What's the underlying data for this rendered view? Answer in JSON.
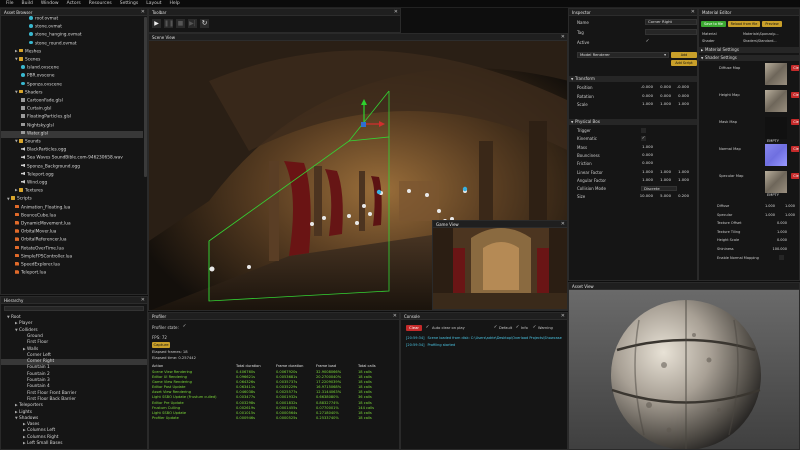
{
  "menu": [
    "File",
    "Build",
    "Window",
    "Actors",
    "Resources",
    "Settings",
    "Layout",
    "Help"
  ],
  "asset_browser": {
    "title": "Asset Browser",
    "rows": [
      {
        "label": "roof.ovmat",
        "indent": 28,
        "icon": "sphere"
      },
      {
        "label": "stone.ovmat",
        "indent": 28,
        "icon": "sphere"
      },
      {
        "label": "stone_hanging.ovmat",
        "indent": 28,
        "icon": "sphere"
      },
      {
        "label": "stone_round.ovmat",
        "indent": 28,
        "icon": "sphere"
      },
      {
        "label": "Meshes",
        "indent": 14,
        "icon": "folder",
        "tri": "▶"
      },
      {
        "label": "Scenes",
        "indent": 14,
        "icon": "folder",
        "tri": "▼"
      },
      {
        "label": "Island.ovscene",
        "indent": 20,
        "icon": "sphere"
      },
      {
        "label": "PBR.ovscene",
        "indent": 20,
        "icon": "sphere"
      },
      {
        "label": "Sponza.ovscene",
        "indent": 20,
        "icon": "sphere"
      },
      {
        "label": "Shaders",
        "indent": 14,
        "icon": "folder",
        "tri": "▼"
      },
      {
        "label": "CartoonFade.glsl",
        "indent": 20,
        "icon": "file"
      },
      {
        "label": "Curtain.glsl",
        "indent": 20,
        "icon": "file"
      },
      {
        "label": "FloatingParticles.glsl",
        "indent": 20,
        "icon": "file"
      },
      {
        "label": "Nightsky.glsl",
        "indent": 20,
        "icon": "file"
      },
      {
        "label": "Water.glsl",
        "indent": 20,
        "icon": "file",
        "selected": true
      },
      {
        "label": "Sounds",
        "indent": 14,
        "icon": "folder",
        "tri": "▼"
      },
      {
        "label": "BlackParticles.ogg",
        "indent": 20,
        "icon": "sound"
      },
      {
        "label": "Sea Waves SoundBible.com-946230658.wav",
        "indent": 20,
        "icon": "sound"
      },
      {
        "label": "Sponza_Background.ogg",
        "indent": 20,
        "icon": "sound"
      },
      {
        "label": "Teleport.ogg",
        "indent": 20,
        "icon": "sound"
      },
      {
        "label": "Wind.ogg",
        "indent": 20,
        "icon": "sound"
      },
      {
        "label": "Textures",
        "indent": 14,
        "icon": "folder",
        "tri": "▶"
      },
      {
        "label": "Scripts",
        "indent": 6,
        "icon": "folder",
        "tri": "▼"
      },
      {
        "label": "Animation_Floating.lua",
        "indent": 14,
        "icon": "script"
      },
      {
        "label": "BounceCube.lua",
        "indent": 14,
        "icon": "script"
      },
      {
        "label": "DynamicMovement.lua",
        "indent": 14,
        "icon": "script"
      },
      {
        "label": "OrbitalMover.lua",
        "indent": 14,
        "icon": "script"
      },
      {
        "label": "OrbitalReferencer.lua",
        "indent": 14,
        "icon": "script"
      },
      {
        "label": "RotateOverTime.lua",
        "indent": 14,
        "icon": "script"
      },
      {
        "label": "SimpleFPSController.lua",
        "indent": 14,
        "icon": "script"
      },
      {
        "label": "SpeedExplorer.lua",
        "indent": 14,
        "icon": "script"
      },
      {
        "label": "Teleport.lua",
        "indent": 14,
        "icon": "script"
      }
    ]
  },
  "hierarchy": {
    "title": "Hierarchy",
    "rows": [
      {
        "label": "Root",
        "indent": 6,
        "tri": "▼"
      },
      {
        "label": "Player",
        "indent": 14,
        "tri": "▶"
      },
      {
        "label": "Colliders",
        "indent": 14,
        "tri": "▼"
      },
      {
        "label": "Ground",
        "indent": 26,
        "tri": ""
      },
      {
        "label": "First Floor",
        "indent": 26,
        "tri": ""
      },
      {
        "label": "Walls",
        "indent": 22,
        "tri": "▶"
      },
      {
        "label": "Corner Left",
        "indent": 26,
        "tri": ""
      },
      {
        "label": "Corner Right",
        "indent": 26,
        "tri": "",
        "selected": true
      },
      {
        "label": "Fountain 1",
        "indent": 26,
        "tri": ""
      },
      {
        "label": "Fountain 2",
        "indent": 26,
        "tri": ""
      },
      {
        "label": "Fountain 3",
        "indent": 26,
        "tri": ""
      },
      {
        "label": "Fountain 4",
        "indent": 26,
        "tri": ""
      },
      {
        "label": "First Floor Front Barrier",
        "indent": 26,
        "tri": ""
      },
      {
        "label": "First Floor Back Barrier",
        "indent": 26,
        "tri": ""
      },
      {
        "label": "Teleporters",
        "indent": 14,
        "tri": "▶"
      },
      {
        "label": "Lights",
        "indent": 14,
        "tri": "▶"
      },
      {
        "label": "Shadows",
        "indent": 14,
        "tri": "▼"
      },
      {
        "label": "Vases",
        "indent": 22,
        "tri": "▶"
      },
      {
        "label": "Columns Left",
        "indent": 22,
        "tri": "▶"
      },
      {
        "label": "Columns Right",
        "indent": 22,
        "tri": "▶"
      },
      {
        "label": "Left Small Bases",
        "indent": 22,
        "tri": "▶"
      }
    ]
  },
  "toolbar": {
    "title": "Toolbar"
  },
  "scene_view": {
    "title": "Scene View"
  },
  "game_view": {
    "title": "Game View"
  },
  "profiler": {
    "title": "Profiler",
    "profiler_state": "Profiler state:",
    "fps": "FPS: 72",
    "capture": "Capture",
    "elapsed_frames": "Elapsed frames: 18",
    "elapsed_time": "Elapsed time: 0.257442",
    "columns": [
      "Action",
      "Total duration",
      "Frame duration",
      "Frame load",
      "Total calls"
    ],
    "rows": [
      [
        "Scene View Rendering",
        "0.406760s",
        "0.0067920s",
        "32.9008066%",
        "18 calls"
      ],
      [
        "Editor UI Rendering",
        "0.096621s",
        "0.0053681s",
        "20.2700040%",
        "18 calls"
      ],
      [
        "Game View Rendering",
        "0.064326s",
        "0.0035737s",
        "17.2209039%",
        "18 calls"
      ],
      [
        "Editor Post Update",
        "0.063411s",
        "0.0035229s",
        "16.9715068%",
        "18 calls"
      ],
      [
        "Asset View Rendering",
        "0.046038s",
        "0.0025577s",
        "12.3144063%",
        "18 calls"
      ],
      [
        "Light SSBO Update (Frustum culled)",
        "0.003477s",
        "0.0001932s",
        "0.6638080%",
        "36 calls"
      ],
      [
        "Editor Pre Update",
        "0.003298s",
        "0.0001832s",
        "0.8832774%",
        "18 calls"
      ],
      [
        "Frustum Culling",
        "0.002619s",
        "0.0001455s",
        "0.0770001%",
        "144 calls"
      ],
      [
        "Light SSBO Update",
        "0.001015s",
        "0.0000564s",
        "0.2718040%",
        "18 calls"
      ],
      [
        "Profiler Update",
        "0.000946s",
        "0.0000525s",
        "0.2533740%",
        "18 calls"
      ]
    ]
  },
  "console": {
    "title": "Console",
    "clear": "Clear",
    "auto_clear": "Auto clear on play",
    "filters": [
      "Default",
      "Info",
      "Warning"
    ],
    "logs": [
      {
        "time": "[20:59:34]",
        "text": "Scene loaded from disk: C:\\Users\\adrie\\Desktop\\Overload Projects\\Showcase"
      },
      {
        "time": "[20:59:34]",
        "text": "Profiling started"
      }
    ]
  },
  "inspector": {
    "title": "Inspector",
    "name_label": "Name",
    "name_value": "Corner Right",
    "tag_label": "Tag",
    "tag_value": "",
    "active_label": "Active",
    "component_select": "Model Renderer",
    "add_component": "Add Component",
    "add_script": "Add Script",
    "transform": {
      "header": "Transform",
      "rows": [
        {
          "label": "Position",
          "values": [
            "-0.000",
            "0.000",
            "-0.000"
          ]
        },
        {
          "label": "Rotation",
          "values": [
            "0.000",
            "0.000",
            "0.000"
          ]
        },
        {
          "label": "Scale",
          "values": [
            "1.000",
            "1.000",
            "1.000"
          ]
        }
      ]
    },
    "physical_box": {
      "header": "Physical Box",
      "rows": [
        {
          "label": "Trigger",
          "kind": "check",
          "checked": false
        },
        {
          "label": "Kinematic",
          "kind": "check",
          "checked": true
        },
        {
          "label": "Mass",
          "kind": "vals",
          "values": [
            "1.000"
          ]
        },
        {
          "label": "Bounciness",
          "kind": "vals",
          "values": [
            "0.000"
          ]
        },
        {
          "label": "Friction",
          "kind": "vals",
          "values": [
            "0.000"
          ]
        },
        {
          "label": "Linear Factor",
          "kind": "vals",
          "values": [
            "1.000",
            "1.000",
            "1.000"
          ]
        },
        {
          "label": "Angular Factor",
          "kind": "vals",
          "values": [
            "1.000",
            "1.000",
            "1.000"
          ]
        },
        {
          "label": "Collision Mode",
          "kind": "text",
          "values": [
            "Discrete"
          ]
        },
        {
          "label": "Size",
          "kind": "vals",
          "values": [
            "10.000",
            "5.000",
            "0.200"
          ]
        }
      ]
    }
  },
  "material_editor": {
    "title": "Material Editor",
    "buttons": [
      "Save to file",
      "Reload from file",
      "Preview"
    ],
    "material_label": "Material",
    "material_value": "Materials\\Sponza\\p...",
    "shader_label": "Shader",
    "shader_value": "Shaders\\Standard...",
    "material_settings": "Material Settings",
    "shader_settings": "Shader Settings",
    "maps": [
      {
        "label": "Diffuse Map",
        "texture": "stone",
        "name": ""
      },
      {
        "label": "Height Map",
        "texture": "stone",
        "name": ""
      },
      {
        "label": "Mask Map",
        "texture": "empty",
        "name": "EMPTY"
      },
      {
        "label": "Normal Map",
        "texture": "normal",
        "name": ""
      },
      {
        "label": "Specular Map",
        "texture": "stone",
        "name": "EMPTY"
      }
    ],
    "clear": "Cle",
    "props": [
      {
        "label": "Diffuse",
        "values": [
          "1.000",
          "1.000"
        ]
      },
      {
        "label": "Specular",
        "values": [
          "1.000",
          "1.000"
        ]
      },
      {
        "label": "Texture Offset",
        "values": [
          "0.000"
        ]
      },
      {
        "label": "Texture Tiling",
        "values": [
          "1.000"
        ]
      },
      {
        "label": "Height Scale",
        "values": [
          "0.000"
        ]
      },
      {
        "label": "Shininess",
        "values": [
          "100.000"
        ]
      },
      {
        "label": "Enable Normal Mapping",
        "values": []
      }
    ]
  },
  "asset_view": {
    "title": "Asset View"
  }
}
